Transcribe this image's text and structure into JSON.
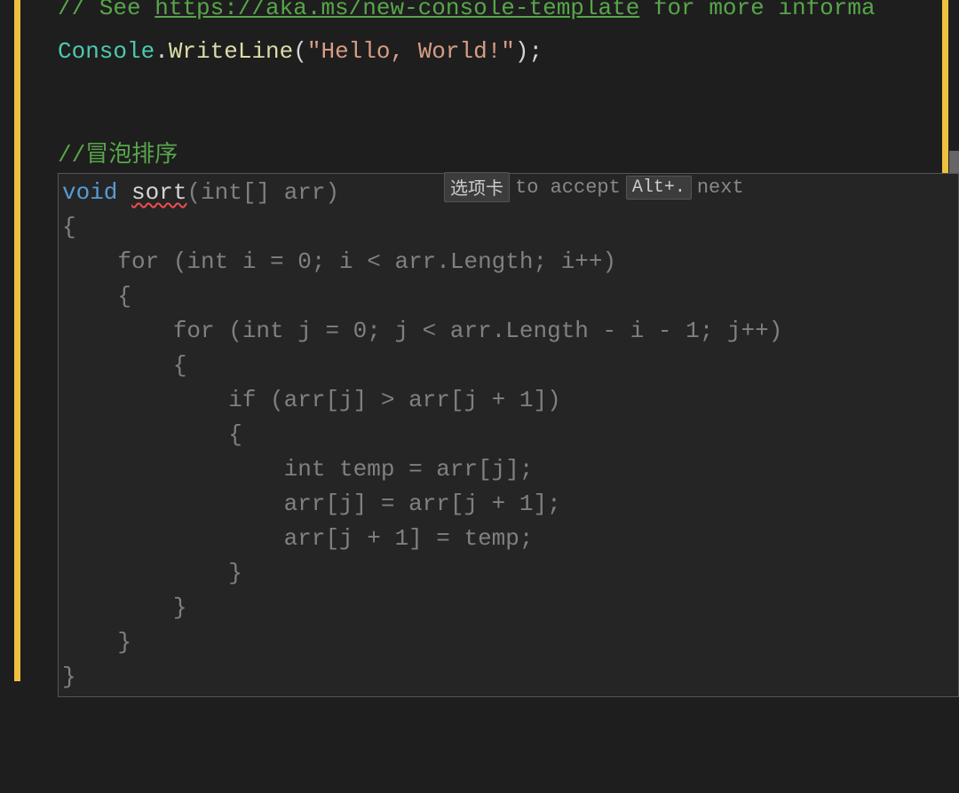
{
  "top_comment": {
    "prefix": "// See ",
    "link": "https://aka.ms/new-console-template",
    "suffix": " for more informa"
  },
  "console_line": {
    "class": "Console",
    "dot": ".",
    "method": "WriteLine",
    "open": "(",
    "string": "\"Hello, World!\"",
    "close": ");"
  },
  "comment_sort": "//冒泡排序",
  "signature": {
    "void": "void",
    "space1": " ",
    "name": "sort",
    "open": "(",
    "type": "int",
    "brackets": "[]",
    "space2": " ",
    "param": "arr",
    "close": ")"
  },
  "hint": {
    "key1": "选项卡",
    "text1": "to accept",
    "key2": "Alt+.",
    "text2": "next"
  },
  "suggestion_body": "{\n    for (int i = 0; i < arr.Length; i++)\n    {\n        for (int j = 0; j < arr.Length - i - 1; j++)\n        {\n            if (arr[j] > arr[j + 1])\n            {\n                int temp = arr[j];\n                arr[j] = arr[j + 1];\n                arr[j + 1] = temp;\n            }\n        }\n    }\n}"
}
